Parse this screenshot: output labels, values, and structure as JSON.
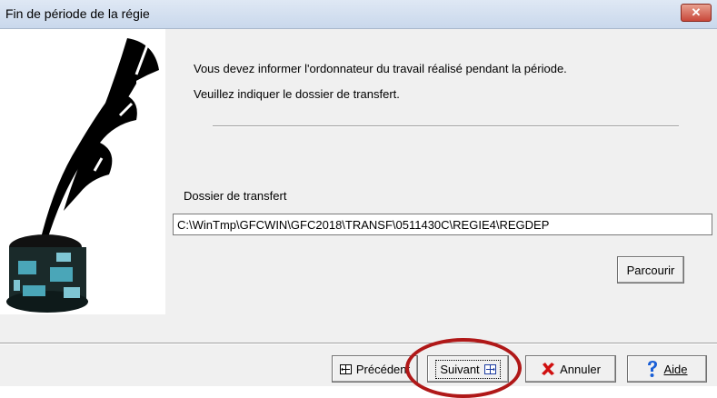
{
  "window": {
    "title": "Fin de période de la régie",
    "close_label": "✕"
  },
  "content": {
    "line1": "Vous devez informer l'ordonnateur du travail réalisé pendant la période.",
    "line2": "Veuillez indiquer le dossier de transfert.",
    "dossier_label": "Dossier de transfert",
    "dossier_value": "C:\\WinTmp\\GFCWIN\\GFC2018\\TRANSF\\0511430C\\REGIE4\\REGDEP",
    "browse_label": "Parcourir"
  },
  "buttons": {
    "previous": "Précédent",
    "next": "Suivant",
    "cancel": "Annuler",
    "help": "Aide"
  },
  "icons": {
    "illustration": "quill-inkwell-icon",
    "previous": "expand-box-icon",
    "next": "expand-box-icon",
    "cancel": "red-x-icon",
    "help": "question-mark-icon"
  },
  "colors": {
    "highlight_circle": "#b01818",
    "help_icon": "#1a5fd6",
    "cancel_icon": "#d01010"
  }
}
